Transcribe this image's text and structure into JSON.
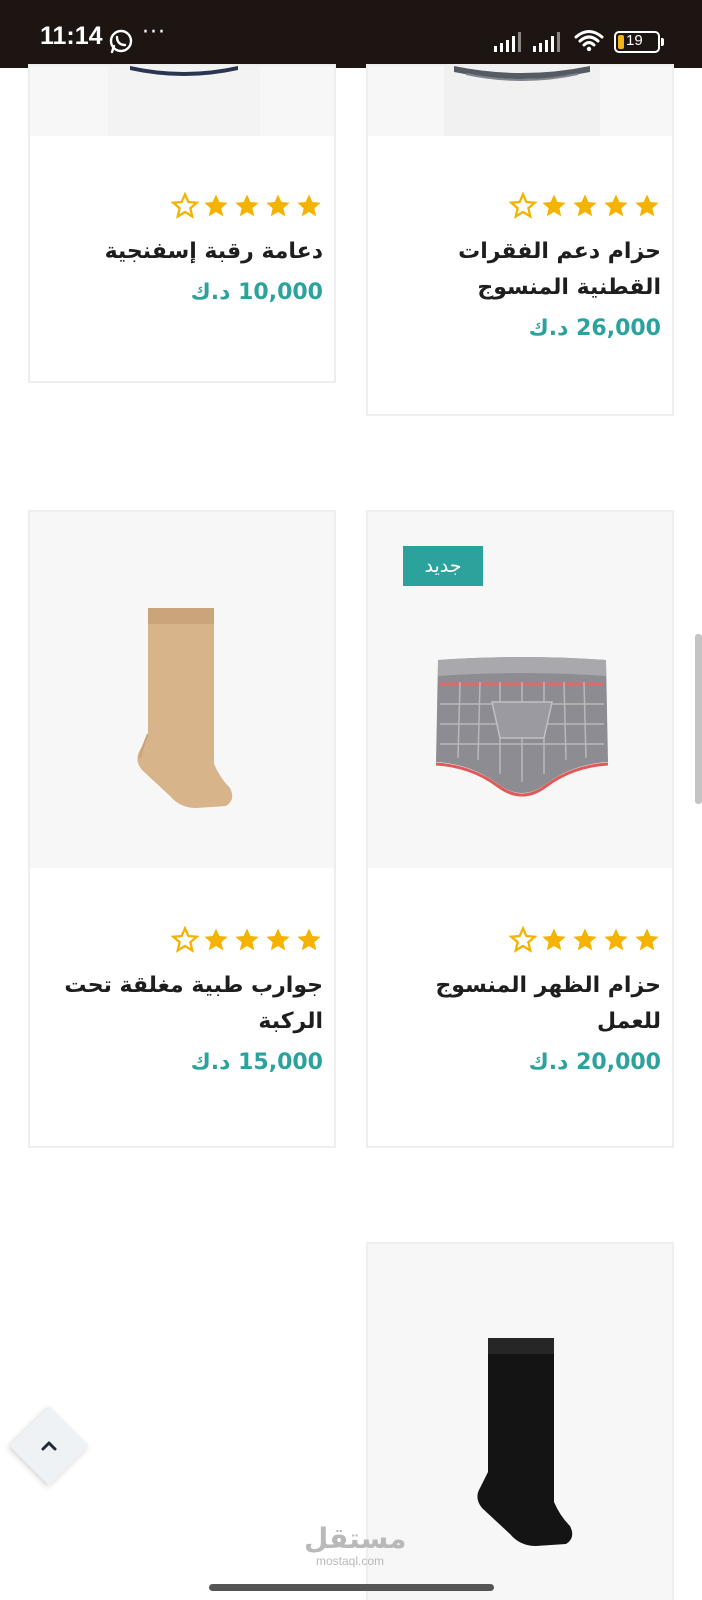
{
  "status_bar": {
    "time": "11:14",
    "dots": "···",
    "battery_level": "19",
    "icons": [
      "whatsapp-icon",
      "signal-icon",
      "signal-icon",
      "wifi-icon",
      "battery-icon"
    ]
  },
  "products": [
    {
      "name": "حزام دعم الفقرات القطنية المنسوج",
      "price": "26,000 د.ك",
      "rating": 4,
      "badge": ""
    },
    {
      "name": "دعامة رقبة إسفنجية",
      "price": "10,000 د.ك",
      "rating": 4,
      "badge": ""
    },
    {
      "name": "حزام الظهر المنسوج للعمل",
      "price": "20,000 د.ك",
      "rating": 4,
      "badge": "جديد"
    },
    {
      "name": "جوارب طبية مغلقة تحت الركبة",
      "price": "15,000 د.ك",
      "rating": 4,
      "badge": ""
    },
    {
      "name": "",
      "price": "",
      "rating": 0,
      "badge": ""
    }
  ],
  "colors": {
    "accent": "#2ba39c",
    "star": "#f5b301",
    "status_bar": "#1c1512"
  },
  "watermark": {
    "main": "مستقل",
    "sub": "mostaql.com"
  },
  "back_to_top_icon": "chevron-up-icon"
}
